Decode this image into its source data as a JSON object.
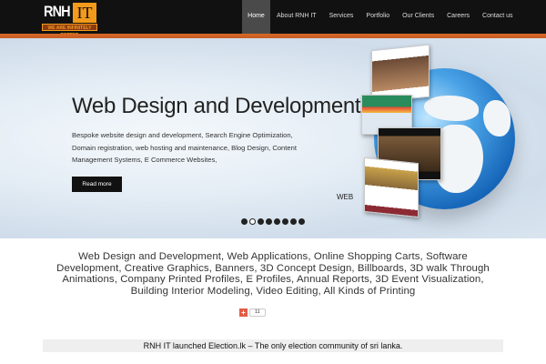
{
  "header": {
    "logo": {
      "name": "RNH",
      "accent": "IT",
      "slogan": "WE ARE INFINITELY BETTER"
    },
    "nav": [
      {
        "label": "Home",
        "active": true
      },
      {
        "label": "About RNH IT"
      },
      {
        "label": "Services"
      },
      {
        "label": "Portfolio"
      },
      {
        "label": "Our Clients"
      },
      {
        "label": "Careers"
      },
      {
        "label": "Contact us"
      }
    ],
    "accent_color": "#d86a2a"
  },
  "hero": {
    "title": "Web Design and Development",
    "description": "Bespoke website design and development, Search Engine Optimization, Domain registration, web hosting and maintenance, Blog Design, Content Management Systems, E Commerce Websites,",
    "button": "Read more",
    "image_caption": "WEB",
    "slides_total": 8,
    "active_slide": 2
  },
  "tagline": "Web Design and Development, Web Applications, Online Shopping Carts, Software Development, Creative Graphics, Banners, 3D Concept Design, Billboards, 3D walk Through Animations, Company Printed Profiles, E Profiles, Annual Reports, 3D Event Visualization, Building Interior Modeling, Video Editing, All Kinds of Printing",
  "share": {
    "icon": "google-plus-icon",
    "count": "11"
  },
  "news": "RNH IT launched Election.lk – The only election community of sri lanka."
}
